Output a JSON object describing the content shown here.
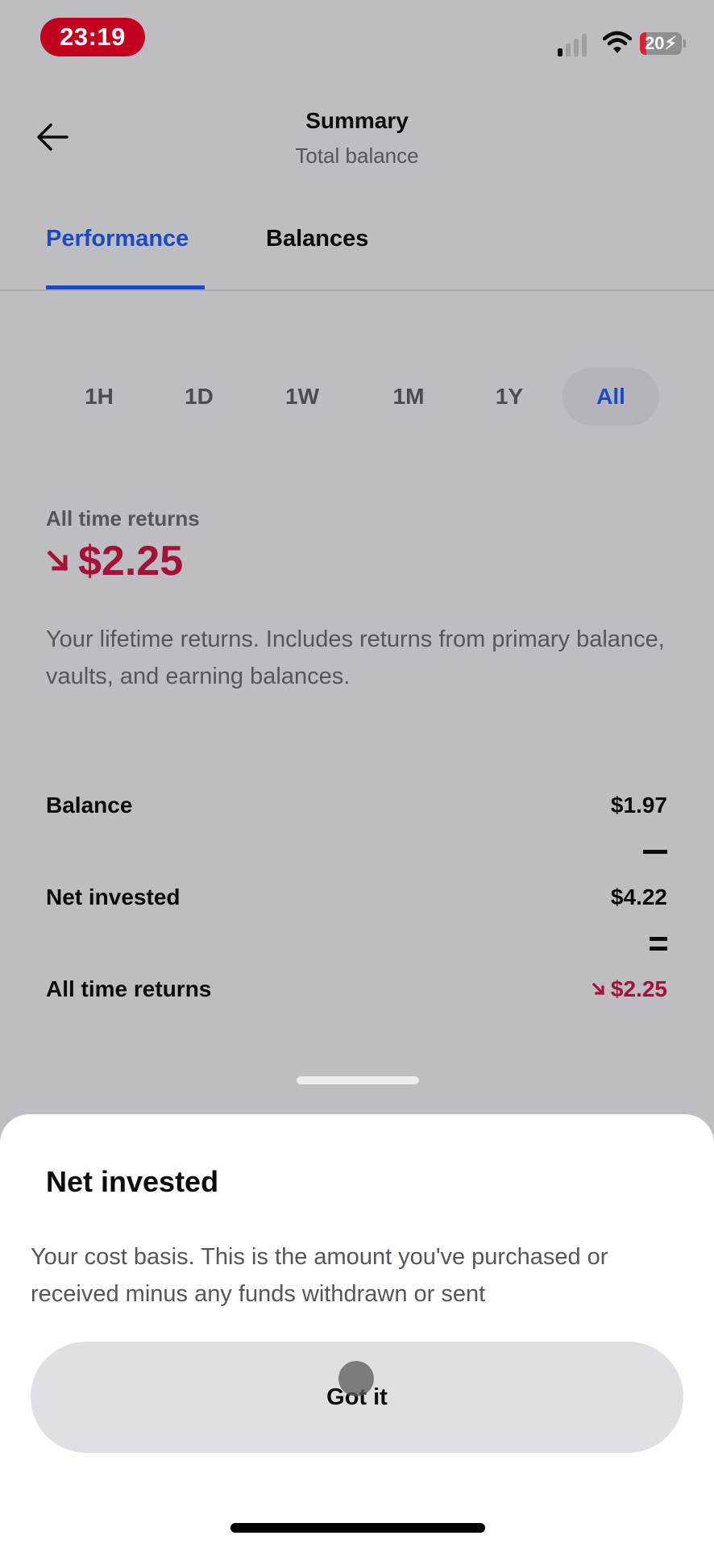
{
  "status_bar": {
    "time": "23:19",
    "battery_level": "20",
    "signal_bars_active": 1,
    "signal_bars_total": 4,
    "icons": [
      "signal-icon",
      "wifi-icon",
      "battery-charging-icon"
    ]
  },
  "header": {
    "back_icon": "arrow-left-icon",
    "title": "Summary",
    "subtitle": "Total balance"
  },
  "tabs": [
    {
      "label": "Performance",
      "active": true
    },
    {
      "label": "Balances",
      "active": false
    }
  ],
  "range_selector": {
    "options": [
      "1H",
      "1D",
      "1W",
      "1M",
      "1Y",
      "All"
    ],
    "selected": "All"
  },
  "returns": {
    "label": "All time returns",
    "direction_icon": "arrow-down-right-icon",
    "value": "$2.25",
    "description": "Your lifetime returns. Includes returns from primary balance, vaults, and earning balances."
  },
  "breakdown": {
    "balance": {
      "label": "Balance",
      "value": "$1.97"
    },
    "operator_1": "minus",
    "net_invested": {
      "label": "Net invested",
      "value": "$4.22"
    },
    "operator_2": "equals",
    "all_time_returns": {
      "label": "All time returns",
      "value": "$2.25",
      "direction_icon": "arrow-down-right-icon"
    }
  },
  "sheet": {
    "title": "Net invested",
    "description": "Your cost basis. This is the amount you've purchased or received minus any funds withdrawn or sent",
    "button_label": "Got it"
  },
  "colors": {
    "accent_blue": "#1a4bc4",
    "negative_red": "#a5113a",
    "time_pill_red": "#c2001f",
    "dimmed_background": "#bebdc2",
    "sheet_background": "#ffffff",
    "button_background": "#e0e0e4"
  }
}
